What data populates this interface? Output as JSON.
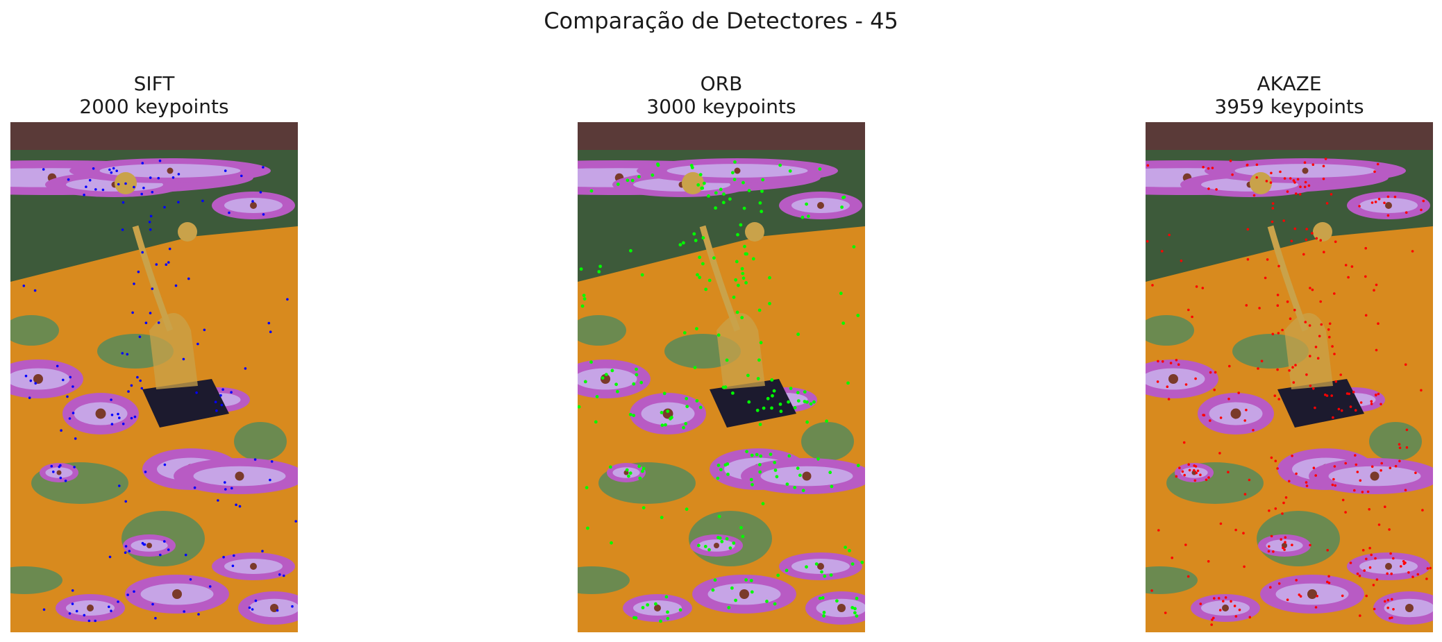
{
  "figure": {
    "title": "Comparação de Detectores - 45"
  },
  "panels": [
    {
      "name": "SIFT",
      "count_label": "2000 keypoints",
      "keypoints": 2000,
      "marker_color": "#0000ff"
    },
    {
      "name": "ORB",
      "count_label": "3000 keypoints",
      "keypoints": 3000,
      "marker_color": "#00ff00"
    },
    {
      "name": "AKAZE",
      "count_label": "3959 keypoints",
      "keypoints": 3959,
      "marker_color": "#ff0000"
    }
  ],
  "scene": {
    "sky_wall_color": "#5a3a38",
    "grass_color": "#3d5a3a",
    "tablecloth_color": "#d88a1e",
    "flower_color": "#b85bc4",
    "flower_light_color": "#c9b6ef",
    "leaf_color": "#5f8a55",
    "trophy_gold": "#c9a24a",
    "trophy_base": "#1c1a2e"
  }
}
